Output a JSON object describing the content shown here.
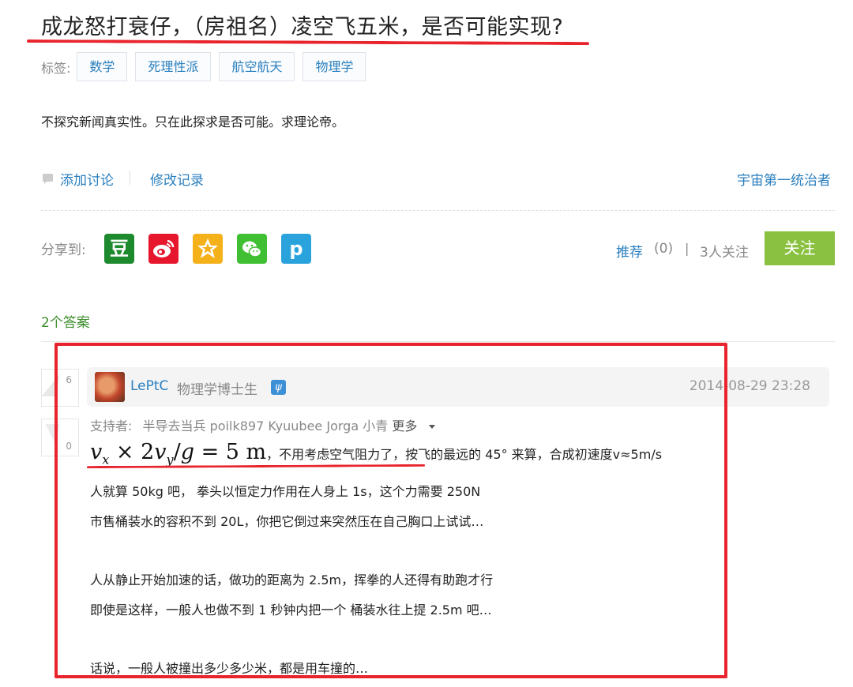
{
  "question": {
    "title": "成龙怒打衰仔，（房祖名）凌空飞五米，是否可能实现?",
    "tags_label": "标签:",
    "tags": [
      "数学",
      "死理性派",
      "航空航天",
      "物理学"
    ],
    "description": "不探究新闻真实性。只在此探求是否可能。求理论帝。",
    "add_discussion": "添加讨论",
    "edit_history": "修改记录",
    "asker": "宇宙第一统治者"
  },
  "share": {
    "label": "分享到:",
    "icons": {
      "douban": "豆",
      "weibo": "weibo-icon",
      "qzone": "qzone-star-icon",
      "wechat": "wechat-icon",
      "p": "p"
    },
    "recommend_label": "推荐",
    "recommend_count": "(0)",
    "separator": "|",
    "followers": "3人关注",
    "follow_button": "关注"
  },
  "answers": {
    "count_label": "2个答案",
    "items": [
      {
        "upvotes": "6",
        "downvotes": "0",
        "author": "LePtC",
        "author_title": "物理学博士生",
        "time": "2014-08-29 23:28",
        "supporters_label": "支持者:",
        "supporters": [
          "半导去当兵",
          "poilk897",
          "Kyuubee",
          "Jorga",
          "小青"
        ],
        "more_label": "更多",
        "lines": [
          "，不用考虑空气阻力了，按飞的最远的 45° 来算，合成初速度v≈5m/s",
          "人就算 50kg 吧， 拳头以恒定力作用在人身上 1s，这个力需要 250N",
          "市售桶装水的容积不到 20L，你把它倒过来突然压在自己胸口上试试…",
          "人从静止开始加速的话，做功的距离为 2.5m，挥拳的人还得有助跑才行",
          "即使是这样，一般人也做不到 1 秒钟内把一个 桶装水往上提 2.5m 吧…",
          "话说，一般人被撞出多少多少米，都是用车撞的…"
        ]
      }
    ]
  },
  "colors": {
    "link": "#2a7fbf",
    "follow_button": "#8ac141",
    "answer_count": "#3c8d2a",
    "highlight": "#e8242d"
  }
}
